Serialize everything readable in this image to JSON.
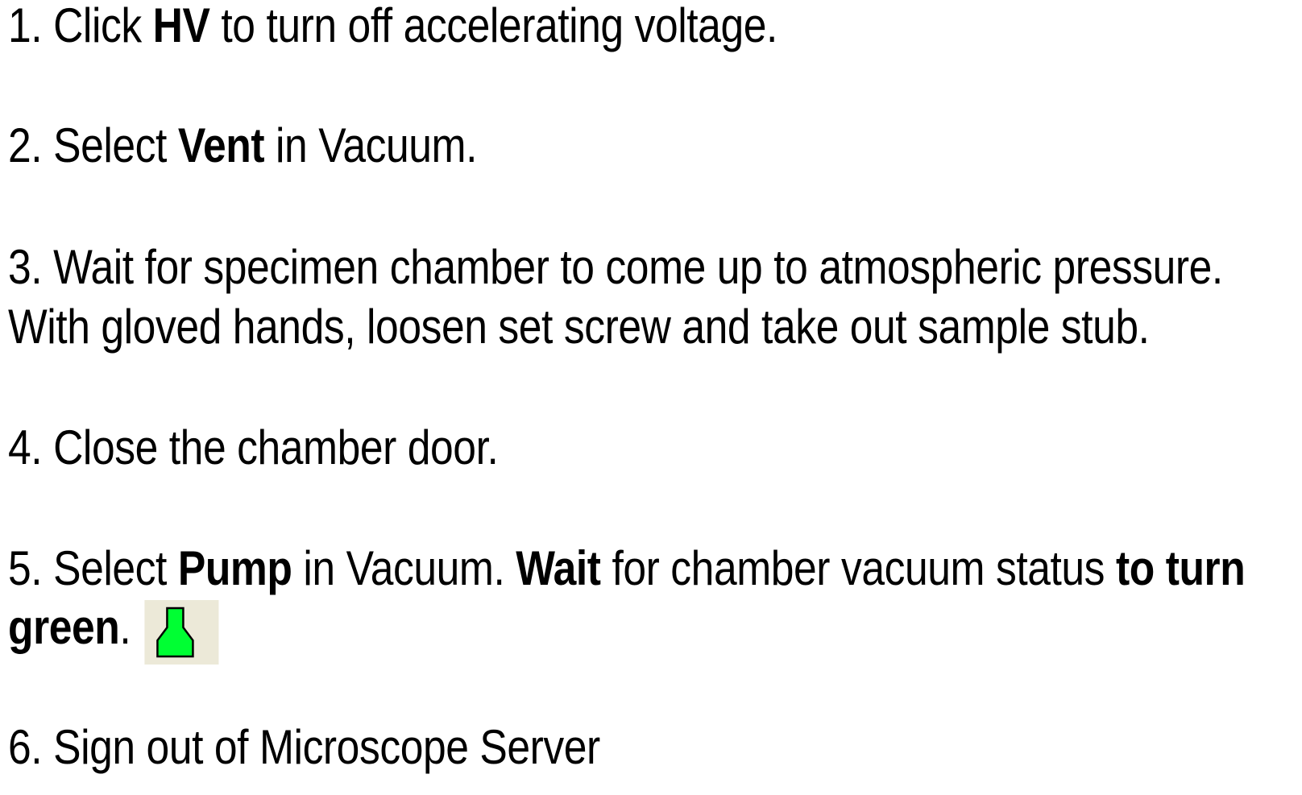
{
  "steps": [
    {
      "number": "1.",
      "t1": "Click ",
      "b1": "HV",
      "t2": " to turn off accelerating voltage."
    },
    {
      "number": "2.",
      "t1": "Select ",
      "b1": "Vent",
      "t2": " in Vacuum."
    },
    {
      "number": "3.",
      "line1": "Wait for specimen chamber to come up to atmospheric pressure.",
      "line2": "With gloved hands, loosen set screw and take out sample stub."
    },
    {
      "number": "4.",
      "text": "Close the chamber door."
    },
    {
      "number": "5.",
      "t1": "Select ",
      "b1": "Pump",
      "t2": " in Vacuum. ",
      "b2": "Wait",
      "t3": " for chamber vacuum status ",
      "b3": "to turn",
      "b4": "green",
      "t4": ".",
      "icon": "vacuum-status-green-icon",
      "icon_color": "#00ff33"
    },
    {
      "number": "6.",
      "text": "Sign out of Microscope Server"
    }
  ]
}
